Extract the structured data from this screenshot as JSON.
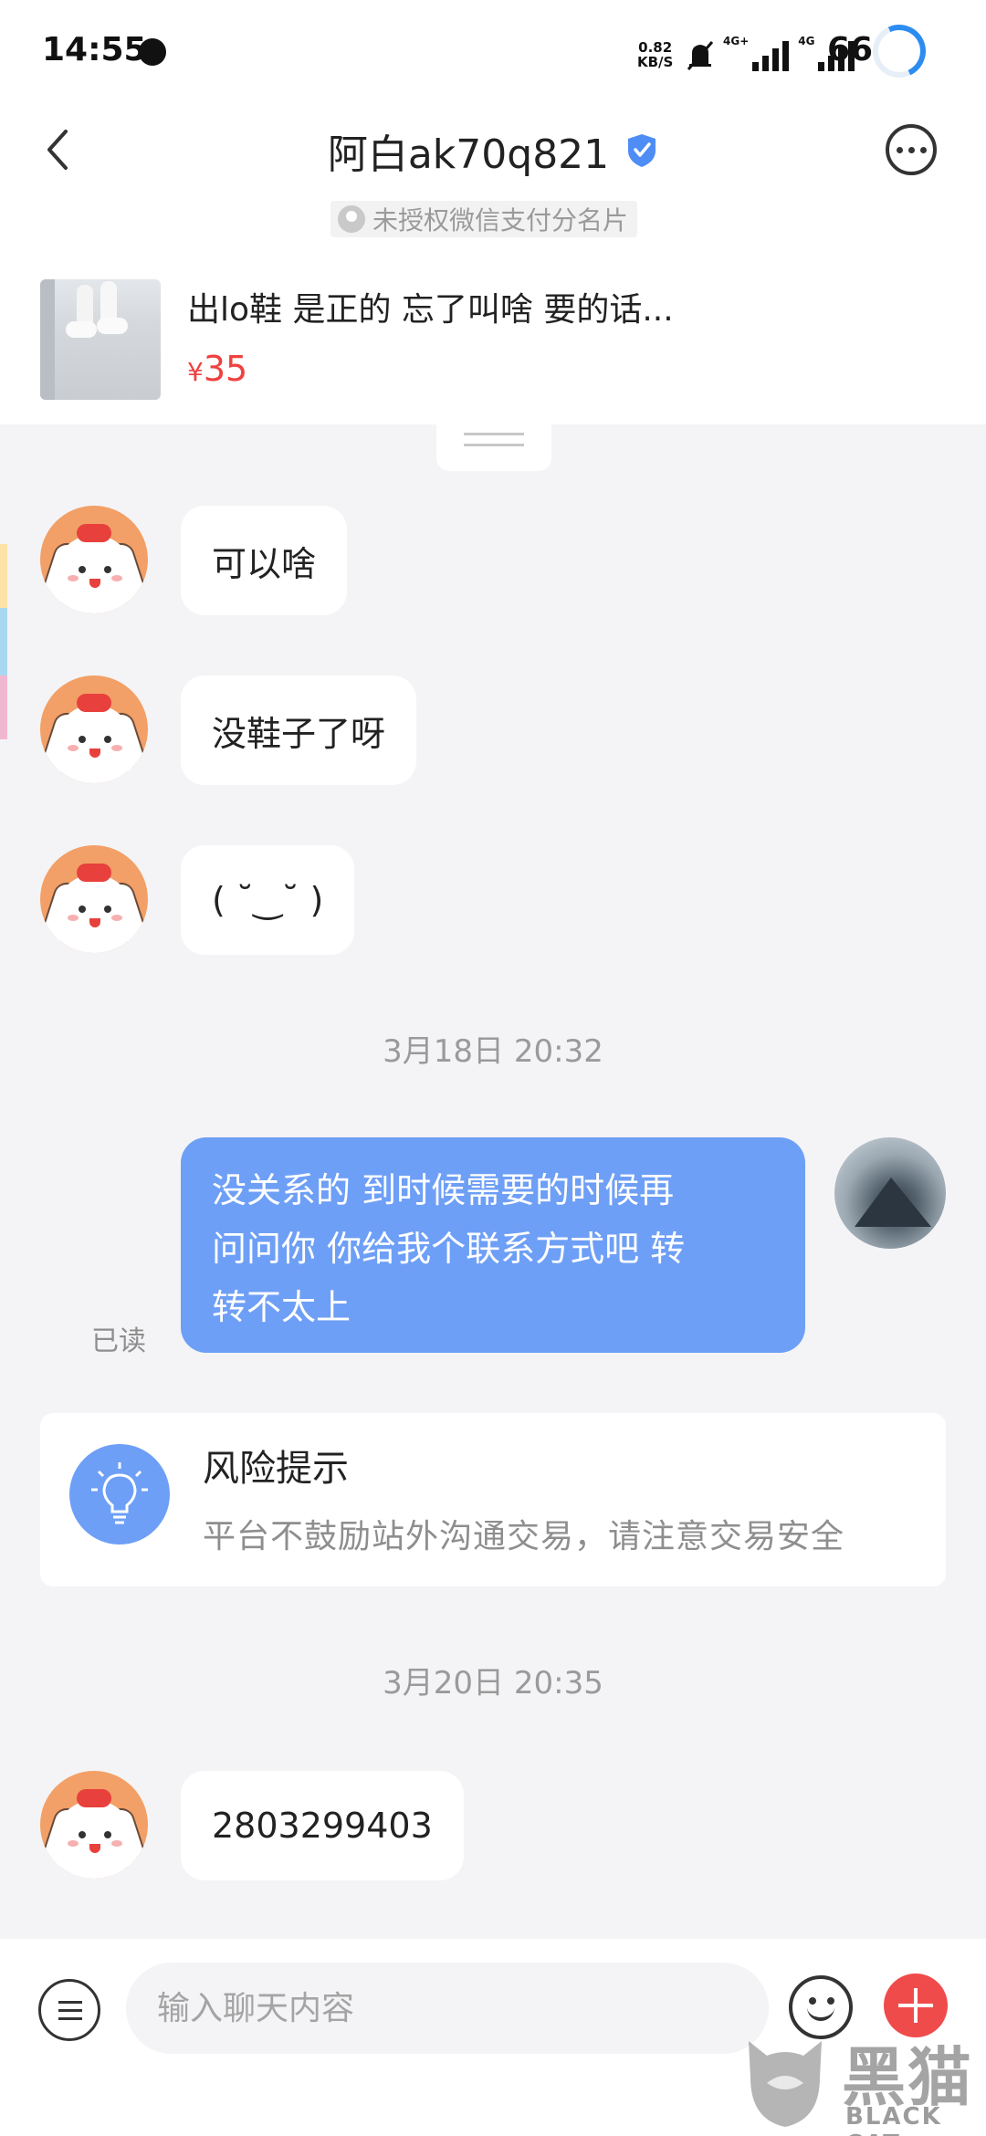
{
  "status_bar": {
    "time": "14:55",
    "speed_value": "0.82",
    "speed_unit": "KB/S",
    "signal1_tag": "4G+",
    "signal2_tag": "4G",
    "battery": "66"
  },
  "header": {
    "title": "阿白ak70q821",
    "wechat_tag": "未授权微信支付分名片"
  },
  "product": {
    "title": "出lo鞋 是正的 忘了叫啥 要的话...",
    "currency": "¥",
    "price": "35"
  },
  "messages": {
    "m1": "可以啥",
    "m2": "没鞋子了呀",
    "m3": "( ˘‿˘ )",
    "time1": "3月18日 20:32",
    "m4_line1": "没关系的 到时候需要的时候再",
    "m4_line2": "问问你 你给我个联系方式吧 转",
    "m4_line3": "转不太上",
    "read": "已读",
    "time2": "3月20日 20:35",
    "m5": "2803299403"
  },
  "risk": {
    "title": "风险提示",
    "text": "平台不鼓励站外沟通交易，请注意交易安全"
  },
  "input": {
    "placeholder": "输入聊天内容"
  },
  "watermark": {
    "cn": "黑猫",
    "en": "BLACK CAT"
  },
  "colors": {
    "accent_blue": "#6e9ff6",
    "price_red": "#f04040",
    "plus_red": "#f04b4b",
    "page_bg": "#f4f4f6"
  },
  "icons": [
    "back-arrow-icon",
    "verified-shield-icon",
    "more-icon",
    "user-icon",
    "lightbulb-icon",
    "menu-icon",
    "emoji-icon",
    "plus-icon"
  ]
}
